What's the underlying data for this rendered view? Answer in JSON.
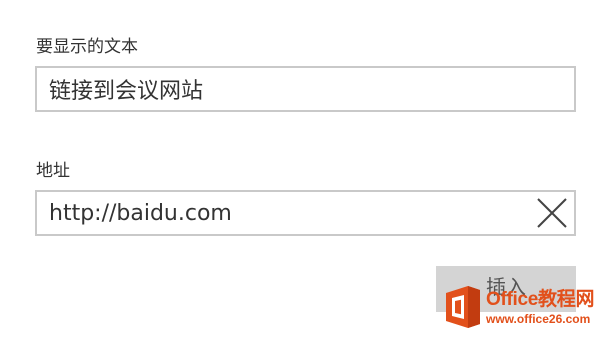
{
  "form": {
    "display_text_label": "要显示的文本",
    "display_text_value": "链接到会议网站",
    "address_label": "地址",
    "address_value": "http://baidu.com",
    "clear_icon": "close-icon",
    "insert_label": "插入"
  },
  "watermark": {
    "title": "Office教程网",
    "url": "www.office26.com",
    "logo_icon": "office-logo-icon",
    "color": "#e2501b"
  }
}
